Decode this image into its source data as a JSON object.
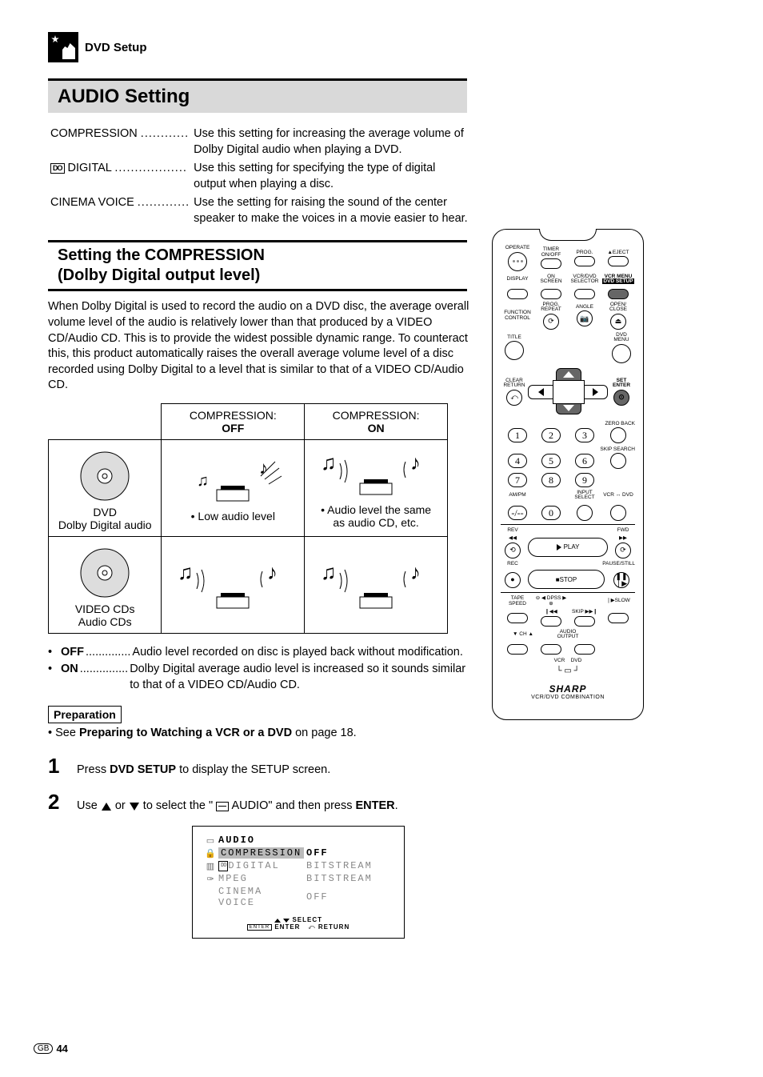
{
  "header": {
    "section": "DVD Setup"
  },
  "title": "AUDIO Setting",
  "settings": {
    "compression": {
      "label": "COMPRESSION",
      "dots": "............",
      "desc": "Use this setting for increasing the average volume of Dolby Digital audio when playing a DVD."
    },
    "digital": {
      "label": "DIGITAL",
      "dots": "..................",
      "desc": "Use this setting for specifying the type of digital output when playing a disc."
    },
    "cinema_voice": {
      "label": "CINEMA VOICE",
      "dots": ".............",
      "desc": "Use the setting for raising the sound of the center speaker to make the voices in a movie easier to hear."
    }
  },
  "subsection_title_line1": "Setting the COMPRESSION",
  "subsection_title_line2": "(Dolby Digital output level)",
  "body_text": "When Dolby Digital is used to record the audio on a DVD disc, the average overall volume level of the audio is relatively lower than that produced by a VIDEO CD/Audio CD. This is to provide the widest possible dynamic range. To counteract this, this product automatically raises the overall average volume level of a disc recorded using Dolby Digital to a level that is similar to that of a VIDEO CD/Audio CD.",
  "table": {
    "head_off_a": "COMPRESSION:",
    "head_off_b": "OFF",
    "head_on_a": "COMPRESSION:",
    "head_on_b": "ON",
    "row1_label_a": "DVD",
    "row1_label_b": "Dolby Digital audio",
    "row1_off": "• Low audio level",
    "row1_on_a": "• Audio level the same",
    "row1_on_b": "as audio CD, etc.",
    "row2_label_a": "VIDEO CDs",
    "row2_label_b": "Audio CDs"
  },
  "bullets": {
    "off_label": "OFF",
    "off_dots": "..............",
    "off_desc": "Audio level recorded on disc is played back without modification.",
    "on_label": "ON",
    "on_dots": "...............",
    "on_desc": "Dolby Digital average audio level is increased so it sounds similar to that of a VIDEO CD/Audio CD."
  },
  "preparation": {
    "box": "Preparation",
    "line_prefix": "• See ",
    "line_bold": "Preparing to Watching a VCR or a DVD",
    "line_suffix": " on page 18."
  },
  "steps": {
    "s1_num": "1",
    "s1_a": "Press ",
    "s1_bold": "DVD SETUP",
    "s1_b": " to display the SETUP screen.",
    "s2_num": "2",
    "s2_a": "Use ",
    "s2_b": " or ",
    "s2_c": " to select the \"",
    "s2_d": " AUDIO\" and then press ",
    "s2_bold": "ENTER",
    "s2_e": "."
  },
  "osd": {
    "title": "AUDIO",
    "r1_label": "COMPRESSION",
    "r1_val": "OFF",
    "r2_label": "DIGITAL",
    "r2_val": "BITSTREAM",
    "r3_label": "MPEG",
    "r3_val": "BITSTREAM",
    "r4_label": "CINEMA VOICE",
    "r4_val": "OFF",
    "f_select": "SELECT",
    "f_enter_box": "ENTER",
    "f_enter": "ENTER",
    "f_return": "RETURN"
  },
  "remote": {
    "operate": "OPERATE",
    "timer": "TIMER\nON/OFF",
    "prog": "PROG.",
    "eject": "EJECT",
    "display": "DISPLAY",
    "on_screen": "ON\nSCREEN",
    "vcr_dvd_sel": "VCR/DVD\nSELECTOR",
    "vcr_menu": "VCR MENU",
    "dvd_setup": "DVD SETUP",
    "func_ctrl": "FUNCTION\nCONTROL",
    "prog_repeat": "PROG.\nREPEAT",
    "angle": "ANGLE",
    "open_close": "OPEN/\nCLOSE",
    "title": "TITLE",
    "dvd_menu": "DVD MENU",
    "clear_return": "CLEAR\nRETURN",
    "set_enter": "SET\nENTER",
    "zero_back": "ZERO BACK",
    "skip_search": "SKIP SEARCH",
    "am_pm": "AM/PM",
    "input_select": "INPUT SELECT",
    "vcr_dvd_toggle": "VCR ↔ DVD",
    "rev": "REV",
    "fwd": "FWD",
    "play": "PLAY",
    "rec": "REC",
    "pause_still": "PAUSE/STILL",
    "stop": "STOP",
    "tape_speed": "TAPE\nSPEED",
    "dpss": "DPSS",
    "skip": "SKIP",
    "slow": "SLOW",
    "ch": "CH",
    "audio_output": "AUDIO\nOUTPUT",
    "vcr": "VCR",
    "dvd": "DVD",
    "brand": "SHARP",
    "brand_sub": "VCR/DVD COMBINATION"
  },
  "footer": {
    "region": "GB",
    "page": "44"
  }
}
